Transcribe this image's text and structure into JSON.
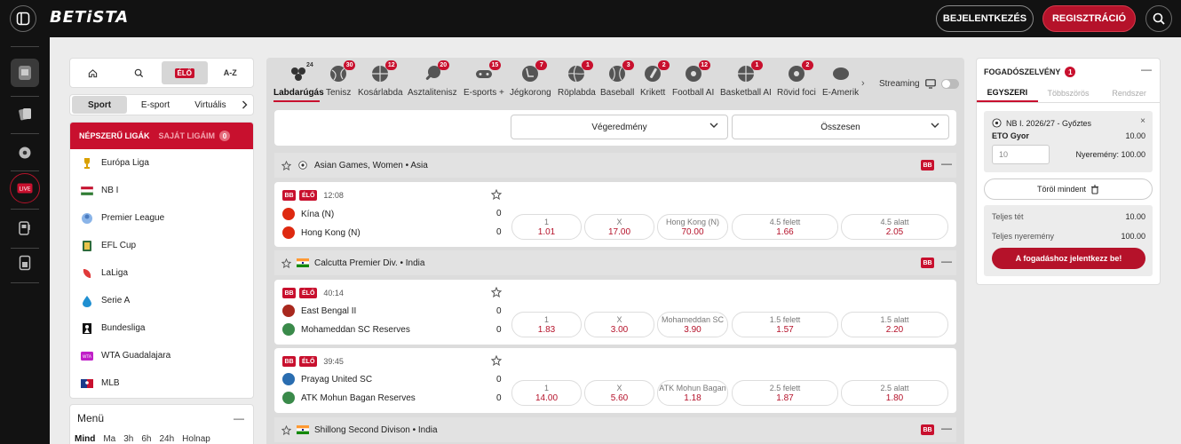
{
  "header": {
    "logo": "BETiSTA",
    "login": "BEJELENTKEZÉS",
    "register": "REGISZTRÁCIÓ"
  },
  "left": {
    "tabs": {
      "live": "ÉLŐ",
      "az": "A-Z"
    },
    "sport_tabs": [
      "Sport",
      "E-sport",
      "Virtuális"
    ],
    "popular": "NÉPSZERŰ LIGÁK",
    "mine": "SAJÁT LIGÁIM",
    "mine_count": "0",
    "leagues": [
      "Európa Liga",
      "NB I",
      "Premier League",
      "EFL Cup",
      "LaLiga",
      "Serie A",
      "Bundesliga",
      "WTA Guadalajara",
      "MLB"
    ],
    "menu_title": "Menü",
    "menu_filters": [
      "Mind",
      "Ma",
      "3h",
      "6h",
      "24h",
      "Holnap"
    ]
  },
  "sports": [
    {
      "label": "Labdarúgás",
      "count": "24"
    },
    {
      "label": "Tenisz",
      "count": "30"
    },
    {
      "label": "Kosárlabda",
      "count": "12"
    },
    {
      "label": "Asztalitenisz",
      "count": "20"
    },
    {
      "label": "E-sports +",
      "count": "15"
    },
    {
      "label": "Jégkorong",
      "count": "7"
    },
    {
      "label": "Röplabda",
      "count": "1"
    },
    {
      "label": "Baseball",
      "count": "3"
    },
    {
      "label": "Krikett",
      "count": "2"
    },
    {
      "label": "Football AI",
      "count": "12"
    },
    {
      "label": "Basketball AI",
      "count": "1"
    },
    {
      "label": "Rövid foci",
      "count": "2"
    },
    {
      "label": "E-Amerik",
      "count": ""
    }
  ],
  "streaming": "Streaming",
  "markets": {
    "result": "Végeredmény",
    "total": "Összesen"
  },
  "bb": "BB",
  "live_label": "ÉLŐ",
  "categories": [
    {
      "name": "Asian Games, Women • Asia"
    },
    {
      "name": "Calcutta Premier Div. • India"
    },
    {
      "name": "Shillong Second Divison • India"
    }
  ],
  "matches": [
    {
      "time": "12:08",
      "home": "Kína (N)",
      "away": "Hong Kong (N)",
      "home_score": "0",
      "away_score": "0",
      "odds": [
        {
          "l": "1",
          "v": "1.01"
        },
        {
          "l": "X",
          "v": "17.00"
        },
        {
          "l": "Hong Kong (N)",
          "v": "70.00"
        },
        {
          "l": "4.5 felett",
          "v": "1.66"
        },
        {
          "l": "4.5 alatt",
          "v": "2.05"
        }
      ]
    },
    {
      "time": "40:14",
      "home": "East Bengal II",
      "away": "Mohameddan SC Reserves",
      "home_score": "0",
      "away_score": "0",
      "odds": [
        {
          "l": "1",
          "v": "1.83"
        },
        {
          "l": "X",
          "v": "3.00"
        },
        {
          "l": "Mohameddan SC",
          "v": "3.90"
        },
        {
          "l": "1.5 felett",
          "v": "1.57"
        },
        {
          "l": "1.5 alatt",
          "v": "2.20"
        }
      ]
    },
    {
      "time": "39:45",
      "home": "Prayag United SC",
      "away": "ATK Mohun Bagan Reserves",
      "home_score": "0",
      "away_score": "0",
      "odds": [
        {
          "l": "1",
          "v": "14.00"
        },
        {
          "l": "X",
          "v": "5.60"
        },
        {
          "l": "ATK Mohun Bagan",
          "v": "1.18"
        },
        {
          "l": "2.5 felett",
          "v": "1.87"
        },
        {
          "l": "2.5 alatt",
          "v": "1.80"
        }
      ]
    }
  ],
  "slip": {
    "title": "FOGADÓSZELVÉNY",
    "count": "1",
    "tabs": [
      "EGYSZERI",
      "Többszörös",
      "Rendszer"
    ],
    "league": "NB I. 2026/27 - Győztes",
    "team": "ETO Gyor",
    "odd": "10.00",
    "stake": "10",
    "payout": "Nyeremény: 100.00",
    "clear": "Töröl mindent",
    "total_stake_label": "Teljes tét",
    "total_stake": "10.00",
    "total_win_label": "Teljes nyeremény",
    "total_win": "100.00",
    "bet_button": "A fogadáshoz jelentkezz be!"
  },
  "colors": {
    "accent": "#c8102e",
    "topbar": "#121212"
  }
}
